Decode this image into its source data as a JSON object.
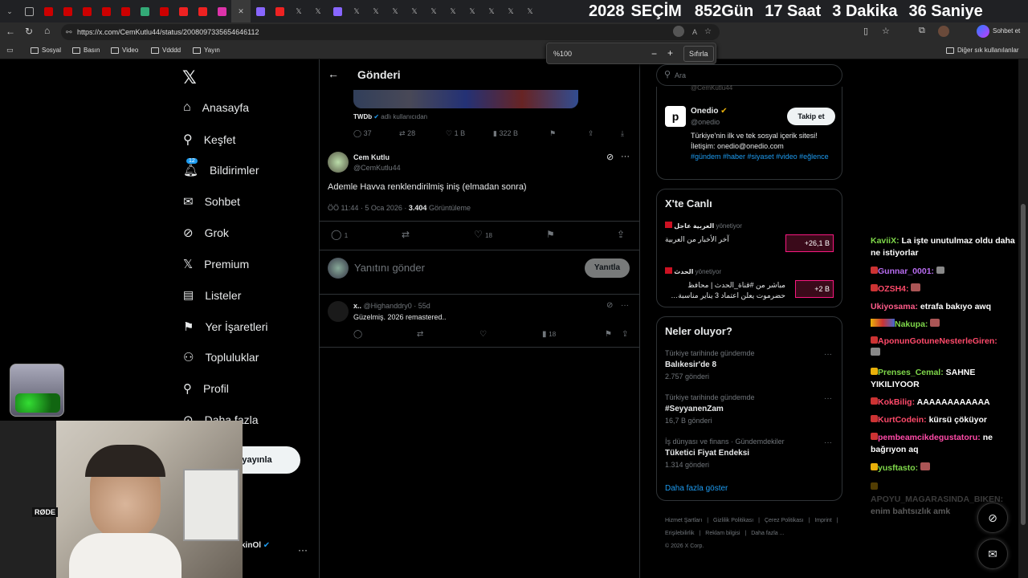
{
  "browser": {
    "countdown": {
      "year": "2028",
      "label": "SEÇİM",
      "days": "852",
      "days_unit": "Gün",
      "hours": "17",
      "hours_unit": "Saat",
      "minutes": "3",
      "minutes_unit": "Dakika",
      "seconds": "36",
      "seconds_unit": "Saniye"
    },
    "url": "https://x.com/CemKutlu44/status/2008097335654646112",
    "profile_label": "Sohbet et",
    "bookmarks": [
      "Sosyal",
      "Basın",
      "Video",
      "Vdddd",
      "Yayın"
    ],
    "other_bookmarks": "Diğer sık kullanılanlar",
    "zoom": {
      "value": "%100",
      "minus": "−",
      "plus": "+",
      "reset": "Sıfırla"
    }
  },
  "nav": {
    "items": [
      "Anasayfa",
      "Keşfet",
      "Bildirimler",
      "Sohbet",
      "Grok",
      "Premium",
      "Listeler",
      "Yer İşaretleri",
      "Topluluklar",
      "Profil",
      "Daha fazla"
    ],
    "notif_badge": "12",
    "post_button": "yayınla",
    "account_name": "kinOl"
  },
  "main": {
    "header": "Gönderi",
    "quoted": {
      "source": "TWDb",
      "source_suffix": "adlı kullanıcıdan",
      "replies": "37",
      "retweets": "28",
      "likes": "1 B",
      "views": "322 B"
    },
    "tweet": {
      "name": "Cem Kutlu",
      "handle": "@CemKutlu44",
      "text": "Ademle Havva renklendirilmiş iniş (elmadan sonra)",
      "time": "ÖÖ 11:44 · 5 Oca 2026 ·",
      "views": "3.404",
      "views_label": "Görüntüleme",
      "replies": "1",
      "likes": "18"
    },
    "reply_placeholder": "Yanıtını gönder",
    "reply_button": "Yanıtla",
    "reply": {
      "name": "x..",
      "handle": "@Highanddry0 · 55d",
      "text": "Güzelmiş. 2026 remastered..",
      "views": "18"
    }
  },
  "right": {
    "search_placeholder": "Ara",
    "follow": {
      "handle_top": "@CemKutlu44",
      "name": "Onedio",
      "handle": "@onedio",
      "button": "Takip et",
      "bio": "Türkiye'nin ilk ve tek sosyal içerik sitesi! İletişim: onedio@onedio.com",
      "tags": "#gündem #haber #siyaset #video #eğlence"
    },
    "live": {
      "title": "X'te Canlı",
      "items": [
        {
          "host": "العربية عاجل",
          "role": "yönetiyor",
          "title": "آخر الأخبار من العربية",
          "count": "+26,1 B"
        },
        {
          "host": "الحدث",
          "role": "yönetiyor",
          "title": "مباشر من #قناة_الحدث | محافظ حضرموت يعلن اعتماد 3 يناير مناسبة…",
          "count": "+2 B"
        }
      ]
    },
    "trends": {
      "title": "Neler oluyor?",
      "items": [
        {
          "context": "Türkiye tarihinde gündemde",
          "name": "Balıkesir'de 8",
          "count": "2.757 gönderi"
        },
        {
          "context": "Türkiye tarihinde gündemde",
          "name": "#SeyyanenZam",
          "count": "16,7 B gönderi"
        },
        {
          "context": "İş dünyası ve finans · Gündemdekiler",
          "name": "Tüketici Fiyat Endeksi",
          "count": "1.314 gönderi"
        }
      ],
      "more": "Daha fazla göster"
    },
    "footer": {
      "links": [
        "Hizmet Şartları",
        "Gizlilik Politikası",
        "Çerez Politikası",
        "Imprint",
        "Erişilebilirlik",
        "Reklam bilgisi",
        "Daha fazla ..."
      ],
      "copyright": "© 2026 X Corp."
    }
  },
  "chat": [
    {
      "user": "KaviiX:",
      "msg": "La işte unutulmaz oldu daha ne istiyorlar",
      "color": "#7fd84a"
    },
    {
      "user": "Gunnar_0001:",
      "msg": "",
      "color": "#b86cf0"
    },
    {
      "user": "OZSH4:",
      "msg": "",
      "color": "#ff4a6a"
    },
    {
      "user": "Ukiyosama:",
      "msg": "etrafa bakıyo awq",
      "color": "#ff5c8a"
    },
    {
      "user": "Nakupa:",
      "msg": "",
      "color": "#7fd84a"
    },
    {
      "user": "AponunGotuneNesterleGiren:",
      "msg": "",
      "color": "#ff4a6a"
    },
    {
      "user": "Prenses_Cemal:",
      "msg": "SAHNE YIKILIYOOR",
      "color": "#7fd84a"
    },
    {
      "user": "KokBilig:",
      "msg": "AAAAAAAAAAAA",
      "color": "#ff4a6a"
    },
    {
      "user": "KurtCodein:",
      "msg": "kürsü çöküyor",
      "color": "#ff4a6a"
    },
    {
      "user": "pembeamcikdegustatoru:",
      "msg": "ne bağrıyon aq",
      "color": "#ff4aa8"
    },
    {
      "user": "yusftasto:",
      "msg": "",
      "color": "#7fd84a"
    },
    {
      "user": "APOYU_MAGARASINDA_BIKEN:",
      "msg": "enim bahtsızlık amk",
      "color": "#3a3a3a"
    }
  ],
  "colors": {
    "accent": "#1d9bf0",
    "bg": "#000000",
    "border": "#2f3336",
    "muted": "#71767b"
  }
}
